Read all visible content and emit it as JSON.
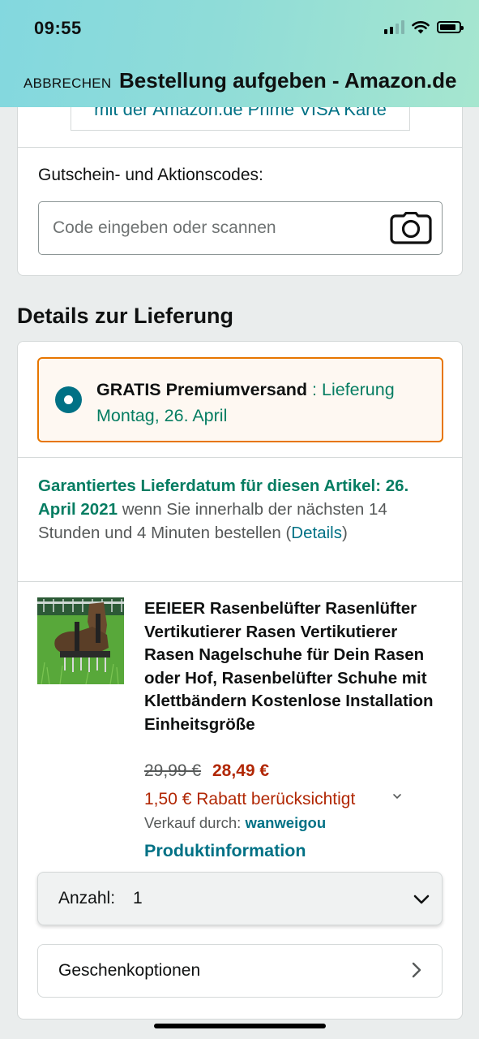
{
  "status_bar": {
    "time": "09:55"
  },
  "header": {
    "cancel_label": "ABBRECHEN",
    "title": "Bestellung aufgeben - Amazon.de"
  },
  "payment": {
    "visa_text": "mit der Amazon.de Prime VISA Karte",
    "coupon_label": "Gutschein- und Aktionscodes:",
    "coupon_placeholder": "Code eingeben oder scannen",
    "coupon_value": ""
  },
  "delivery": {
    "section_title": "Details zur Lieferung",
    "option": {
      "name": "GRATIS Premiumversand",
      "date_text": " : Lieferung Montag, 26. April",
      "selected": true
    },
    "guarantee": {
      "label": "Garantiertes Lieferdatum für diesen Artikel: 26. April 2021",
      "text": " wenn Sie innerhalb der nächsten 14 Stunden und 4 Minuten bestellen",
      "open": " (",
      "link": "Details",
      "close": ")"
    }
  },
  "product": {
    "title": "EEIEER Rasenbelüfter Rasenlüfter Vertikutierer Rasen Vertikutierer Rasen Nagelschuhe für Dein Rasen oder Hof, Rasenbelüfter Schuhe mit Klettbändern Kostenlose Installation Einheitsgröße",
    "price_old": "29,99 €",
    "price_new": "28,49 €",
    "discount": "1,50 € Rabatt berücksichtigt",
    "seller_label": "Verkauf durch: ",
    "seller_name": "wanweigou",
    "info_link": "Produktinformation"
  },
  "quantity": {
    "label": "Anzahl:",
    "value": "1"
  },
  "gift": {
    "label": "Geschenkoptionen"
  },
  "colors": {
    "accent_orange": "#e77600",
    "link_teal": "#007185",
    "delivery_green": "#067d62",
    "price_red": "#b12704"
  },
  "icons": [
    "signal-icon",
    "wifi-icon",
    "battery-icon",
    "camera-icon",
    "chevron-down-icon",
    "chevron-right-icon"
  ]
}
